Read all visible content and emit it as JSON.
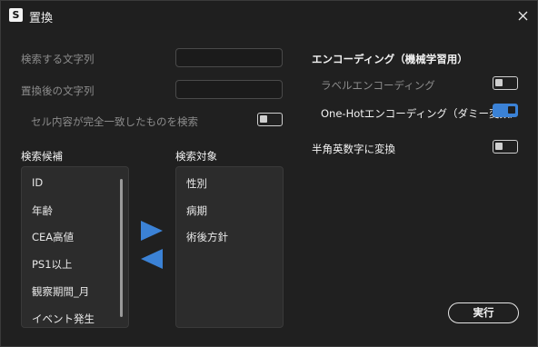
{
  "window": {
    "title": "置換",
    "app_icon_letter": "S"
  },
  "replace": {
    "search_string_label": "検索する文字列",
    "search_string_value": "",
    "replaced_string_label": "置換後の文字列",
    "replaced_string_value": "",
    "exact_match_label": "セル内容が完全一致したものを検索",
    "exact_match": false
  },
  "search": {
    "candidates_label": "検索候補",
    "targets_label": "検索対象",
    "candidates": [
      "ID",
      "年齢",
      "CEA高値",
      "PS1以上",
      "観察期間_月",
      "イベント発生"
    ],
    "targets": [
      "性別",
      "病期",
      "術後方針"
    ]
  },
  "encoding": {
    "heading": "エンコーディング（機械学習用）",
    "label_encoding_label": "ラベルエンコーディング",
    "label_encoding": false,
    "onehot_label": "One-Hotエンコーディング（ダミー変数）",
    "onehot": true,
    "halfwidth_label": "半角英数字に変換",
    "halfwidth": false
  },
  "actions": {
    "run_label": "実行"
  },
  "colors": {
    "accent": "#3b82d6",
    "background": "#202020",
    "panel": "#2c2c2c"
  },
  "icons": {
    "close": "close-icon",
    "move_right": "triangle-right-icon",
    "move_left": "triangle-left-icon"
  }
}
